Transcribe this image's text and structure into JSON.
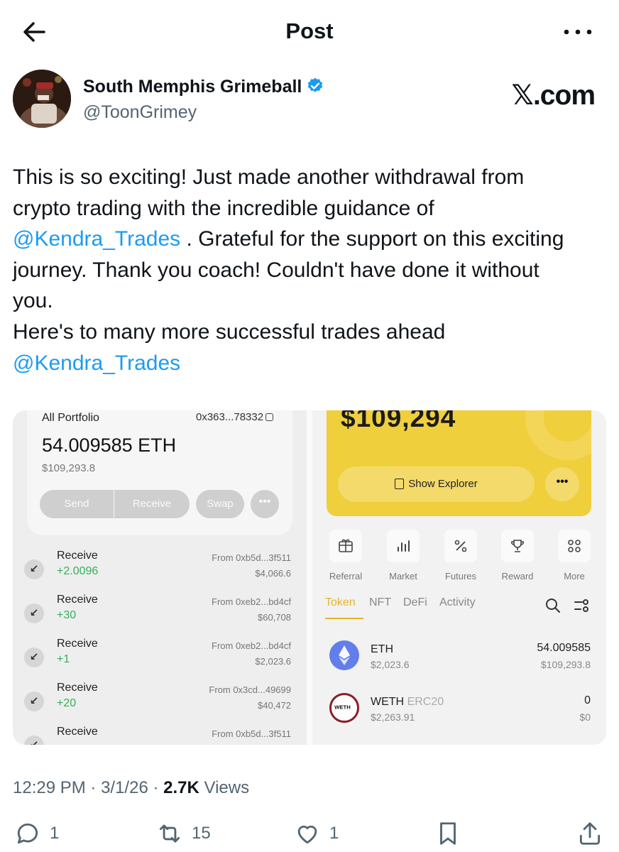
{
  "header": {
    "title": "Post"
  },
  "author": {
    "name": "South Memphis Grimeball",
    "handle": "@ToonGrimey",
    "brand": "𝕏.com"
  },
  "tweet": {
    "line1": "This is so exciting! Just made another withdrawal from",
    "line2": "crypto trading with the incredible guidance of",
    "mention1": "@Kendra_Trades",
    "line3_rest": " . Grateful for the support on this exciting",
    "line4": "journey. Thank you coach! Couldn't have done it without",
    "line5": "you.",
    "line6": "Here's to many more successful trades ahead",
    "mention2": "@Kendra_Trades"
  },
  "wallet_left": {
    "label": "All Portfolio",
    "address": "0x363...78332",
    "amount": "54.009585 ETH",
    "usd": "$109,293.8",
    "buttons": {
      "send": "Send",
      "receive": "Receive",
      "swap": "Swap",
      "more": "•••"
    },
    "transactions": [
      {
        "title": "Receive",
        "amount": "+2.0096",
        "from": "From 0xb5d...3f511",
        "usd": "$4,066.6"
      },
      {
        "title": "Receive",
        "amount": "+30",
        "from": "From 0xeb2...bd4cf",
        "usd": "$60,708"
      },
      {
        "title": "Receive",
        "amount": "+1",
        "from": "From 0xeb2...bd4cf",
        "usd": "$2,023.6"
      },
      {
        "title": "Receive",
        "amount": "+20",
        "from": "From 0x3cd...49699",
        "usd": "$40,472"
      },
      {
        "title": "Receive",
        "amount": "",
        "from": "From 0xb5d...3f511",
        "usd": ""
      }
    ]
  },
  "wallet_right": {
    "balance": "$109,294",
    "explorer_label": "Show Explorer",
    "more": "•••",
    "features": [
      "Referral",
      "Market",
      "Futures",
      "Reward",
      "More"
    ],
    "tabs": [
      "Token",
      "NFT",
      "DeFi",
      "Activity"
    ],
    "assets": [
      {
        "name": "ETH",
        "tag": "",
        "price": "$2,023.6",
        "amount": "54.009585",
        "usd": "$109,293.8"
      },
      {
        "name": "WETH",
        "tag": "ERC20",
        "price": "$2,263.91",
        "amount": "0",
        "usd": "$0"
      }
    ],
    "weth_logo_text": "WETH"
  },
  "meta": {
    "time": "12:29 PM",
    "date": "3/1/26",
    "views_count": "2.7K",
    "views_label": "Views"
  },
  "actions": {
    "replies": "1",
    "reposts": "15",
    "likes": "1"
  },
  "colors": {
    "mention": "#1d9bf0",
    "verified": "#1d9bf0",
    "wallet_yellow": "#efcf3c",
    "positive": "#35b05a"
  }
}
